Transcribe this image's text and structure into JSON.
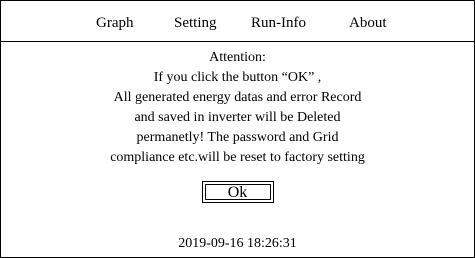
{
  "menu": {
    "items": [
      {
        "label": "Graph"
      },
      {
        "label": "Setting"
      },
      {
        "label": "Run-Info"
      },
      {
        "label": "About"
      }
    ]
  },
  "dialog": {
    "lines": [
      "Attention:",
      "If you click the button “OK” ,",
      "All generated energy datas and error Record",
      "and saved in inverter will be Deleted",
      "permanetly! The password and Grid",
      "compliance etc.will be reset to factory setting"
    ],
    "ok_label": "Ok"
  },
  "status": {
    "datetime": "2019-09-16 18:26:31"
  }
}
